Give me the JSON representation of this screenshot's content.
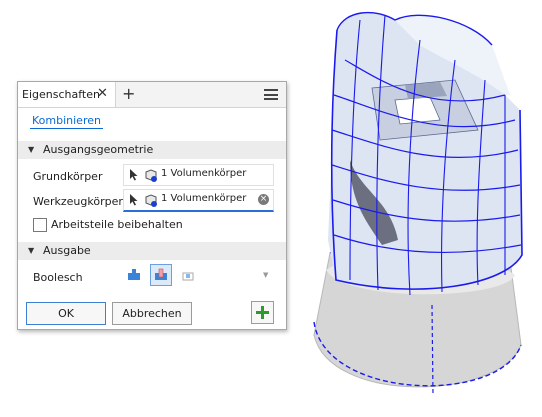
{
  "panel": {
    "tab_label": "Eigenschaften",
    "tab_close_glyph": "✕",
    "tab_add_glyph": "+",
    "menu_icon": "hamburger-menu-icon",
    "operation_link": "Kombinieren",
    "sections": {
      "input": {
        "title": "Ausgangsgeometrie"
      },
      "output": {
        "title": "Ausgabe"
      }
    },
    "base_body": {
      "label": "Grundkörper",
      "value": "1 Volumenkörper"
    },
    "tool_body": {
      "label": "Werkzeugkörper",
      "value": "1 Volumenkörper"
    },
    "keep_toolbodies": {
      "label": "Arbeitsteile beibehalten",
      "checked": false
    },
    "boolean": {
      "label": "Boolesch",
      "options": [
        "join-icon",
        "cut-icon",
        "intersect-icon"
      ],
      "selected": "cut-icon"
    },
    "buttons": {
      "ok": "OK",
      "cancel": "Abbrechen"
    },
    "apply_icon": "plus-icon"
  },
  "colors": {
    "accent_blue": "#0a6ad3",
    "selection_blue": "#1a1aee",
    "apply_green": "#2d9a2d"
  }
}
